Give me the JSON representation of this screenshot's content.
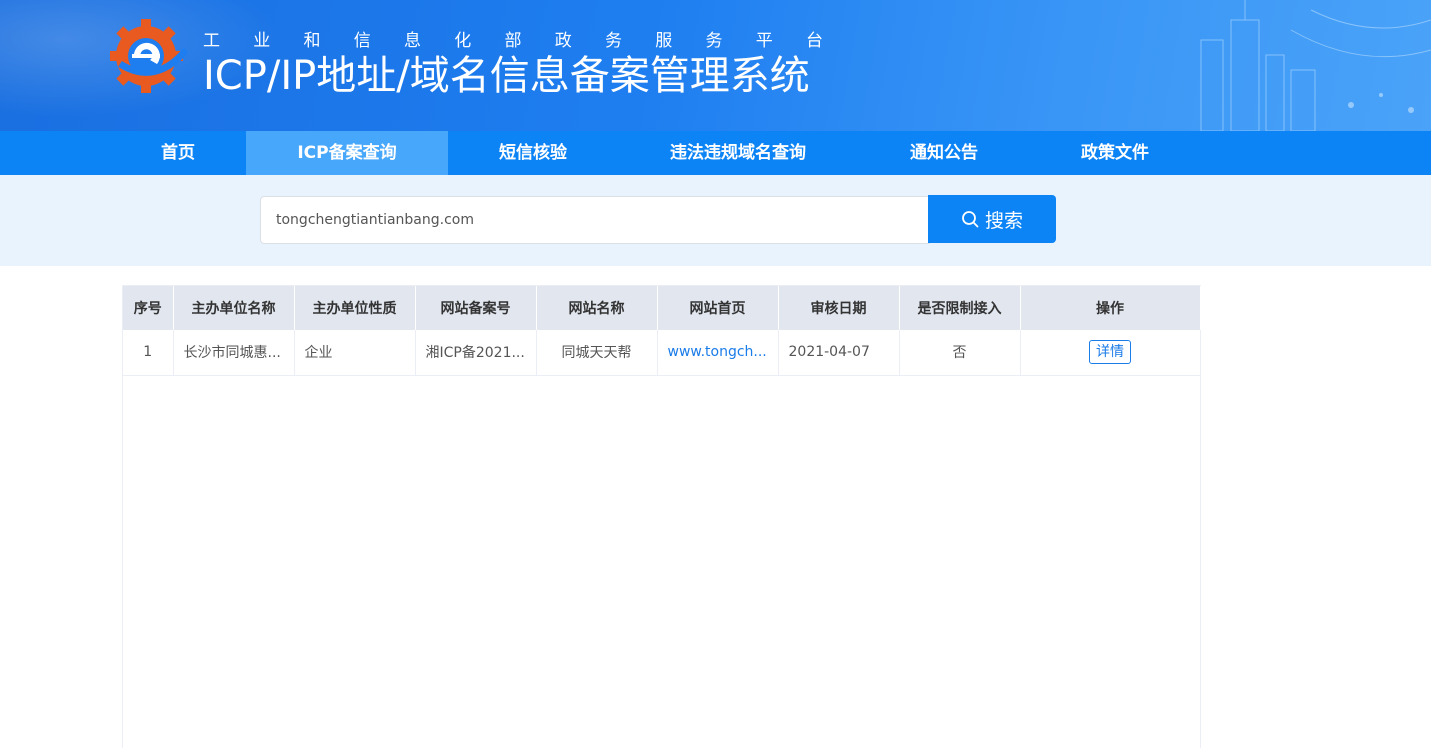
{
  "header": {
    "subtitle_chars": [
      "工",
      "业",
      "和",
      "信",
      "息",
      "化",
      "部",
      "政",
      "务",
      "服",
      "务",
      "平",
      "台"
    ],
    "title": "ICP/IP地址/域名信息备案管理系统"
  },
  "nav": {
    "items": [
      {
        "label": "首页",
        "active": false
      },
      {
        "label": "ICP备案查询",
        "active": true
      },
      {
        "label": "短信核验",
        "active": false
      },
      {
        "label": "违法违规域名查询",
        "active": false
      },
      {
        "label": "通知公告",
        "active": false
      },
      {
        "label": "政策文件",
        "active": false
      }
    ]
  },
  "search": {
    "value": "tongchengtiantianbang.com",
    "button_label": "搜索"
  },
  "table": {
    "headers": [
      "序号",
      "主办单位名称",
      "主办单位性质",
      "网站备案号",
      "网站名称",
      "网站首页",
      "审核日期",
      "是否限制接入",
      "操作"
    ],
    "rows": [
      {
        "index": "1",
        "org_name": "长沙市同城惠...",
        "org_type": "企业",
        "record_no": "湘ICP备2021...",
        "site_name": "同城天天帮",
        "homepage": "www.tongch...",
        "review_date": "2021-04-07",
        "restricted": "否",
        "action": "详情"
      }
    ]
  },
  "colors": {
    "nav_bg": "#0d84f5",
    "nav_active": "#47a7fb",
    "search_band": "#e8f3fe",
    "link": "#1a7ce8"
  }
}
